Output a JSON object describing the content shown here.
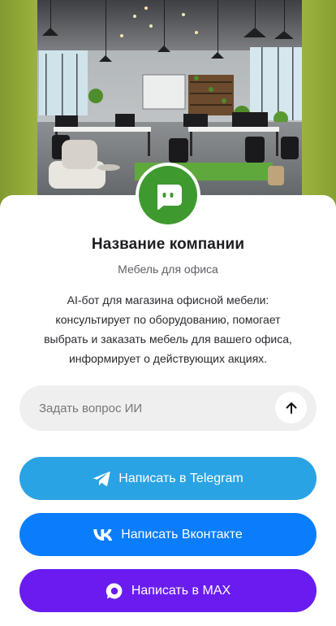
{
  "company": {
    "name": "Название компании",
    "subtitle": "Мебель для офиса",
    "description": "AI-бот для магазина офисной мебели: консультирует по оборудованию, помогает выбрать и заказать мебель для вашего офиса, информирует о действующих акциях."
  },
  "ask": {
    "placeholder": "Задать вопрос ИИ",
    "send_icon": "arrow-up-icon"
  },
  "buttons": {
    "telegram": {
      "label": "Написать в Telegram",
      "icon": "telegram-icon",
      "color": "#2aa3e4"
    },
    "vk": {
      "label": "Написать Вконтакте",
      "icon": "vk-icon",
      "color": "#0a7dfc"
    },
    "max": {
      "label": "Написать в MAX",
      "icon": "max-icon",
      "color": "#6a1cf0"
    }
  },
  "colors": {
    "avatar": "#3e9a2f",
    "accent_green": "#94a63a"
  },
  "avatar_icon": "chat-bot-icon"
}
